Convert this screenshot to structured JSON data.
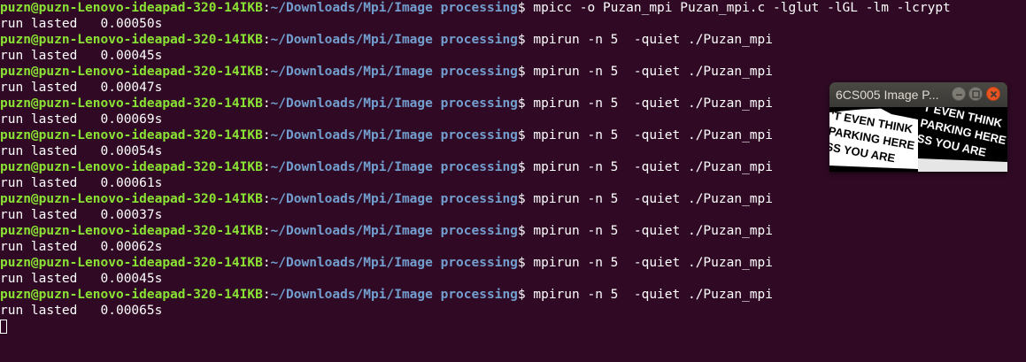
{
  "terminal": {
    "user_host": "puzn@puzn-Lenovo-ideapad-320-14IKB",
    "colon": ":",
    "path": "~/Downloads/Mpi/Image processing",
    "prompt_symbol": "$",
    "compile_command": " mpicc -o Puzan_mpi Puzan_mpi.c -lglut -lGL -lm -lcrypt",
    "run_command": " mpirun -n 5  -quiet ./Puzan_mpi",
    "result_prefix": "run lasted   ",
    "results": [
      "0.00050s",
      "0.00045s",
      "0.00047s",
      "0.00069s",
      "0.00054s",
      "0.00061s",
      "0.00037s",
      "0.00062s",
      "0.00045s",
      "0.00065s"
    ],
    "colors": {
      "background": "#300a24",
      "user_host": "#8ae234",
      "path": "#729fcf",
      "text": "#ffffff"
    }
  },
  "image_window": {
    "title": "6CS005 Image P...",
    "buttons": [
      "minimize-icon",
      "maximize-icon",
      "close-icon"
    ],
    "image_text": {
      "left_panel": [
        "'T EVEN THINK",
        "PARKING HERE",
        "SS YOU ARE"
      ],
      "right_panel": [
        "T EVEN THINK",
        "PARKING HERE",
        "SS YOU ARE"
      ]
    }
  }
}
